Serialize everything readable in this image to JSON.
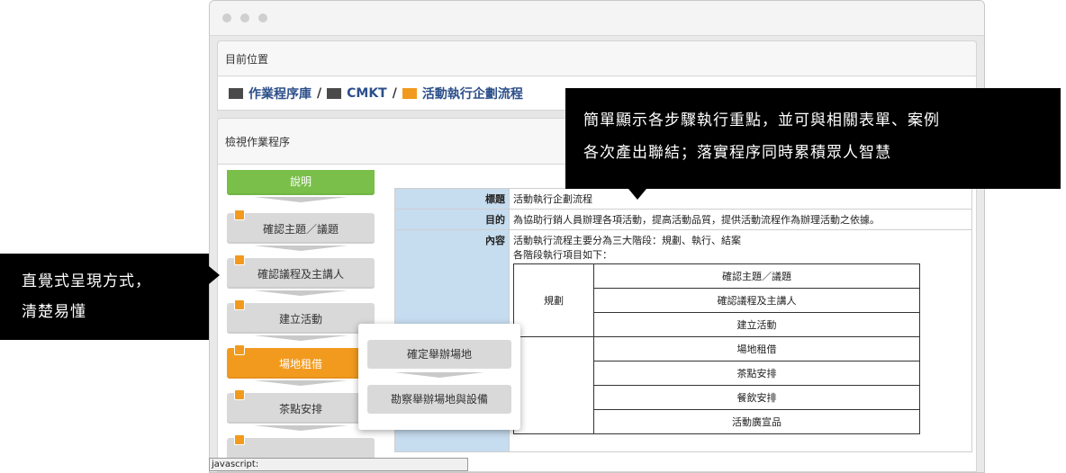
{
  "breadcrumb_panel_title": "目前位置",
  "breadcrumb": [
    "作業程序庫",
    "CMKT",
    "活動執行企劃流程"
  ],
  "view_panel_title": "檢視作業程序",
  "flow_steps": [
    {
      "label": "說明",
      "state": "active-green"
    },
    {
      "label": "確認主題／議題",
      "state": "normal"
    },
    {
      "label": "確認議程及主講人",
      "state": "normal"
    },
    {
      "label": "建立活動",
      "state": "normal"
    },
    {
      "label": "場地租借",
      "state": "selected-orange"
    },
    {
      "label": "茶點安排",
      "state": "normal"
    }
  ],
  "info": {
    "title_label": "標題",
    "title_value": "活動執行企劃流程",
    "purpose_label": "目的",
    "purpose_value": "為協助行銷人員辦理各項活動，提高活動品質，提供活動流程作為辦理活動之依據。",
    "content_label": "內容",
    "content_line1": "活動執行流程主要分為三大階段：規劃、執行、結案",
    "content_line2": "各階段執行項目如下：",
    "phase_plan": "規劃",
    "items": [
      "確認主題／議題",
      "確認議程及主講人",
      "建立活動",
      "場地租借",
      "茶點安排",
      "餐飲安排",
      "活動廣宣品"
    ]
  },
  "popup": {
    "items": [
      "確定舉辦場地",
      "勘察舉辦場地與設備"
    ]
  },
  "status_bar": "javascript:",
  "callout_top": [
    "簡單顯示各步驟執行重點，並可與相關表單、案例",
    "各次產出聯結；落實程序同時累積眾人智慧"
  ],
  "callout_left": [
    "直覺式呈現方式，",
    "清楚易懂"
  ],
  "colors": {
    "accent_green": "#79bf4a",
    "accent_orange": "#f29a1e",
    "link_blue": "#2c4f8a",
    "label_blue": "#c6dcef"
  }
}
